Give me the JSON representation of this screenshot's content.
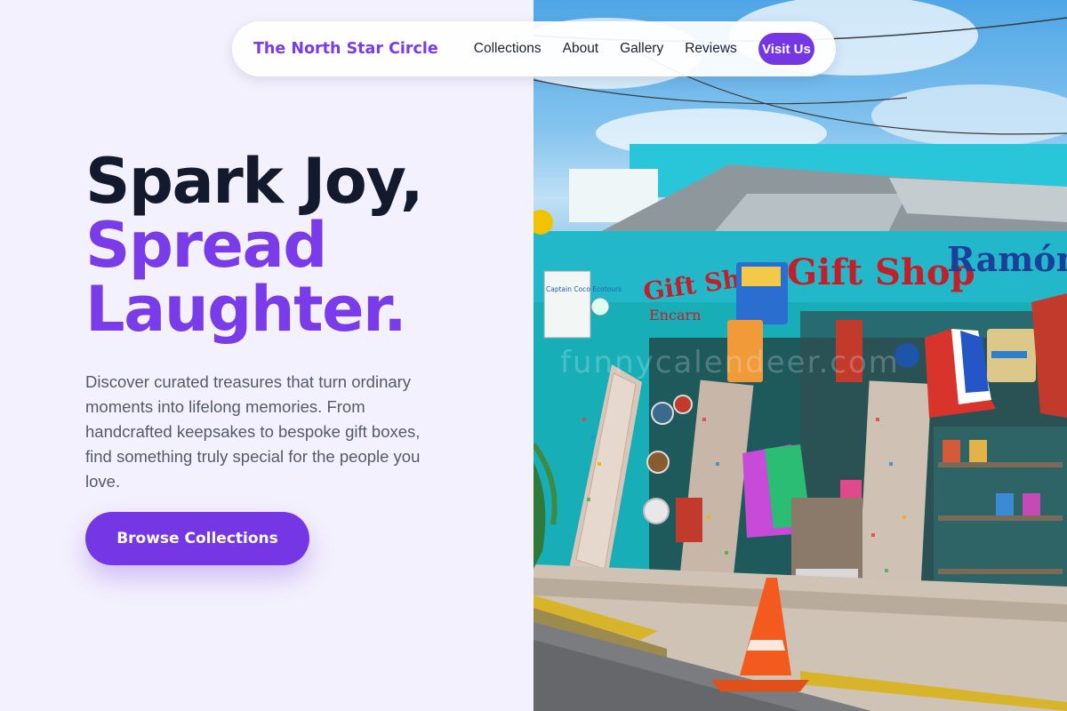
{
  "nav": {
    "brand": "The North Star Circle",
    "links": [
      "Collections",
      "About",
      "Gallery",
      "Reviews"
    ],
    "cta": "Visit Us"
  },
  "hero": {
    "headline_line1": "Spark Joy,",
    "headline_line2": "Spread",
    "headline_line3": "Laughter.",
    "description": "Discover curated treasures that turn ordinary moments into lifelong memories. From handcrafted keepsakes to bespoke gift boxes, find something truly special for the people you love.",
    "button": "Browse Collections"
  },
  "photo": {
    "signs": [
      "Gift Shop",
      "Gift Shop",
      "Ramón",
      "Captain Coco Ecotours",
      "Encarn"
    ],
    "watermark": "funnycalendeer.com"
  },
  "colors": {
    "accent": "#7536e4",
    "headline_dark": "#141a2e",
    "background": "#f3f1fd",
    "shop_teal": "#1bc2c8"
  }
}
